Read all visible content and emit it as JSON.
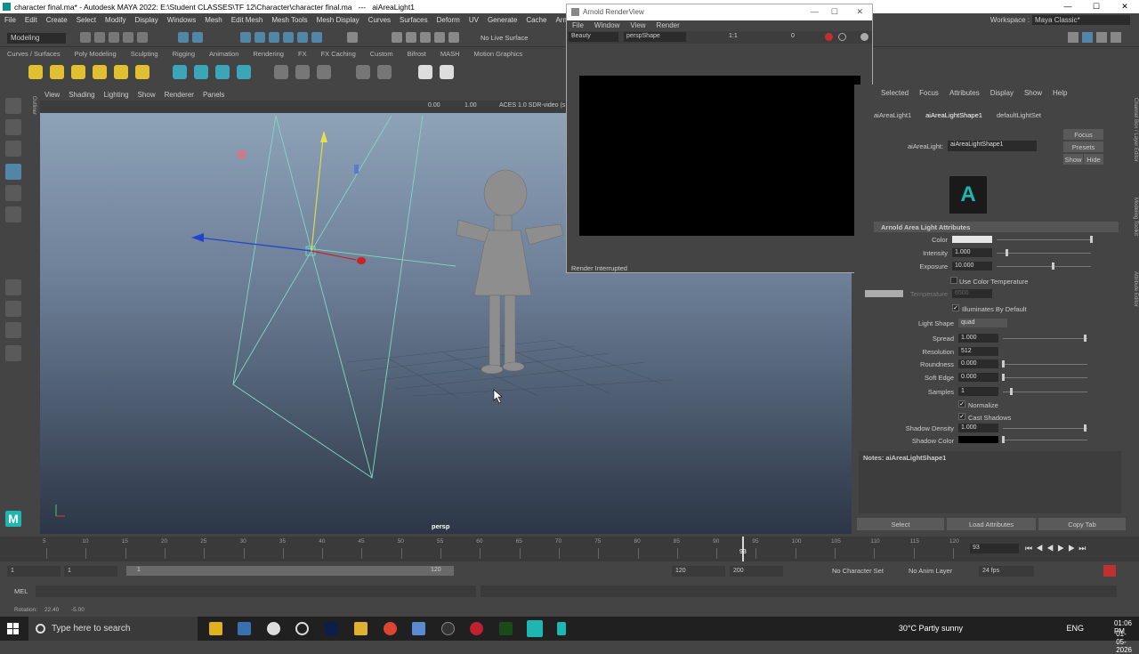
{
  "window": {
    "title": "character final.ma* - Autodesk MAYA 2022: E:\\Student CLASSES\\TF 12\\Character\\character final.ma   ---   aiAreaLight1",
    "controls": [
      "—",
      "☐",
      "✕"
    ]
  },
  "menus": [
    "File",
    "Edit",
    "Create",
    "Select",
    "Modify",
    "Display",
    "Windows",
    "Mesh",
    "Edit Mesh",
    "Mesh Tools",
    "Mesh Display",
    "Curves",
    "Surfaces",
    "Deform",
    "UV",
    "Generate",
    "Cache",
    "Arnold"
  ],
  "workspace": {
    "label": "Workspace :",
    "value": "Maya Classic*"
  },
  "status": {
    "mode": "Modeling",
    "live_surface": "No Live Surface"
  },
  "shelf_tabs": [
    "Curves / Surfaces",
    "Poly Modeling",
    "Sculpting",
    "Rigging",
    "Animation",
    "Rendering",
    "FX",
    "FX Caching",
    "Custom",
    "Bifrost",
    "MASH",
    "Motion Graphics"
  ],
  "viewport": {
    "menu": [
      "View",
      "Shading",
      "Lighting",
      "Show",
      "Renderer",
      "Panels"
    ],
    "val1": "0.00",
    "val2": "1.00",
    "colorspace": "ACES 1.0 SDR-video (s",
    "camera": "persp",
    "outliner_tab": "Outliner"
  },
  "renderview": {
    "title": "Arnold RenderView",
    "menu": [
      "File",
      "Window",
      "View",
      "Render"
    ],
    "aov": "Beauty",
    "camera": "perspShape",
    "ratio": "1:1",
    "exposure": "0",
    "status": "Render Interrupted"
  },
  "attr_editor": {
    "menu": [
      "Selected",
      "Focus",
      "Attributes",
      "Display",
      "Show",
      "Help"
    ],
    "tabs": [
      "aiAreaLight1",
      "aiAreaLightShape1",
      "defaultLightSet"
    ],
    "node_label": "aiAreaLight:",
    "node_name": "aiAreaLightShape1",
    "buttons": {
      "focus": "Focus",
      "presets": "Presets",
      "show": "Show",
      "hide": "Hide"
    },
    "section": "Arnold Area Light Attributes",
    "attrs": {
      "color": "Color",
      "intensity": "Intensity",
      "intensity_v": "1.000",
      "exposure": "Exposure",
      "exposure_v": "10.000",
      "use_color_temp": "Use Color Temperature",
      "temperature": "Temperature",
      "temperature_v": "6500",
      "illuminates": "Illuminates By Default",
      "light_shape": "Light Shape",
      "light_shape_v": "quad",
      "spread": "Spread",
      "spread_v": "1.000",
      "resolution": "Resolution",
      "resolution_v": "512",
      "roundness": "Roundness",
      "roundness_v": "0.000",
      "soft_edge": "Soft Edge",
      "soft_edge_v": "0.000",
      "samples": "Samples",
      "samples_v": "1",
      "normalize": "Normalize",
      "cast_shadows": "Cast Shadows",
      "shadow_density": "Shadow Density",
      "shadow_density_v": "1.000",
      "shadow_color": "Shadow Color"
    },
    "notes": "Notes:  aiAreaLightShape1",
    "bottom": [
      "Select",
      "Load Attributes",
      "Copy Tab"
    ],
    "side_tabs": [
      "Channel Box / Layer Editor",
      "Modeling Toolkit",
      "Attribute Editor"
    ]
  },
  "timeline": {
    "ticks": [
      "5",
      "10",
      "15",
      "20",
      "25",
      "30",
      "35",
      "40",
      "45",
      "50",
      "55",
      "60",
      "65",
      "70",
      "75",
      "80",
      "85",
      "90",
      "95",
      "100",
      "105",
      "110",
      "115",
      "120"
    ],
    "current": "93",
    "frame_field": "93"
  },
  "range": {
    "start": "1",
    "start2": "1",
    "inner_start": "1",
    "inner_end": "120",
    "end": "120",
    "end2": "200",
    "char_set": "No Character Set",
    "anim_layer": "No Anim Layer",
    "fps": "24 fps"
  },
  "mel": {
    "label": "MEL"
  },
  "help": {
    "label": "Rotation:",
    "v1": "22.40",
    "v2": "-5.00"
  },
  "taskbar": {
    "search": "Type here to search",
    "weather": "30°C  Partly sunny",
    "lang": "ENG",
    "time": "01:06 PM",
    "date": "01-05-2026"
  },
  "colors": {
    "accent": "#5285a6",
    "cyan": "#1db6b0",
    "light_line": "#7fd9c0"
  }
}
